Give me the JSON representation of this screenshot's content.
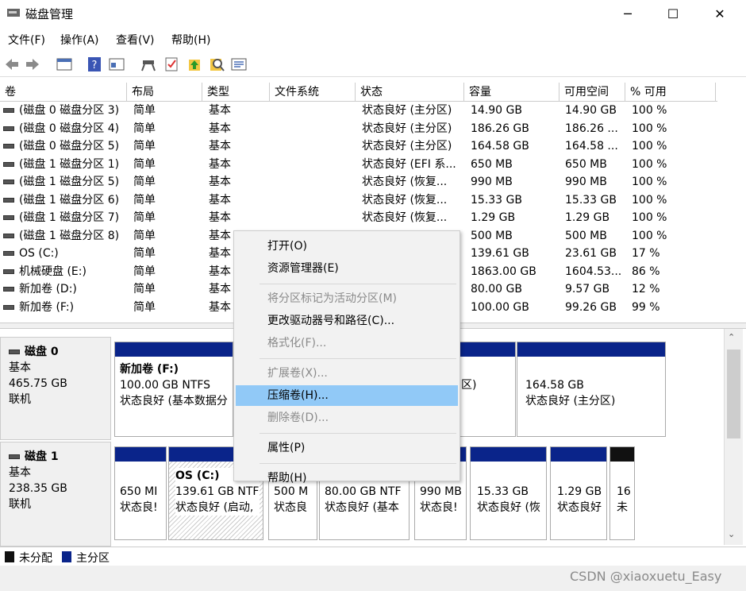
{
  "window": {
    "title": "磁盘管理",
    "minimize": "─",
    "maximize": "☐",
    "close": "✕"
  },
  "menu": [
    "文件(F)",
    "操作(A)",
    "查看(V)",
    "帮助(H)"
  ],
  "toolbar": [
    "back-icon",
    "forward-icon",
    "console-icon",
    "help-icon",
    "properties-icon",
    "connect-icon",
    "check-icon",
    "up-icon",
    "search-icon",
    "list-icon"
  ],
  "columns": [
    "卷",
    "布局",
    "类型",
    "文件系统",
    "状态",
    "容量",
    "可用空间",
    "% 可用"
  ],
  "volumes": [
    [
      "(磁盘 0 磁盘分区 3)",
      "简单",
      "基本",
      "",
      "状态良好 (主分区)",
      "14.90 GB",
      "14.90 GB",
      "100 %"
    ],
    [
      "(磁盘 0 磁盘分区 4)",
      "简单",
      "基本",
      "",
      "状态良好 (主分区)",
      "186.26 GB",
      "186.26 ...",
      "100 %"
    ],
    [
      "(磁盘 0 磁盘分区 5)",
      "简单",
      "基本",
      "",
      "状态良好 (主分区)",
      "164.58 GB",
      "164.58 ...",
      "100 %"
    ],
    [
      "(磁盘 1 磁盘分区 1)",
      "简单",
      "基本",
      "",
      "状态良好 (EFI 系...",
      "650 MB",
      "650 MB",
      "100 %"
    ],
    [
      "(磁盘 1 磁盘分区 5)",
      "简单",
      "基本",
      "",
      "状态良好 (恢复...",
      "990 MB",
      "990 MB",
      "100 %"
    ],
    [
      "(磁盘 1 磁盘分区 6)",
      "简单",
      "基本",
      "",
      "状态良好 (恢复...",
      "15.33 GB",
      "15.33 GB",
      "100 %"
    ],
    [
      "(磁盘 1 磁盘分区 7)",
      "简单",
      "基本",
      "",
      "状态良好 (恢复...",
      "1.29 GB",
      "1.29 GB",
      "100 %"
    ],
    [
      "(磁盘 1 磁盘分区 8)",
      "简单",
      "基本",
      "",
      "",
      "500 MB",
      "500 MB",
      "100 %"
    ],
    [
      "OS (C:)",
      "简单",
      "基本",
      "",
      "",
      "139.61 GB",
      "23.61 GB",
      "17 %"
    ],
    [
      "机械硬盘 (E:)",
      "简单",
      "基本",
      "",
      "",
      "1863.00 GB",
      "1604.53...",
      "86 %"
    ],
    [
      "新加卷 (D:)",
      "简单",
      "基本",
      "",
      "",
      "80.00 GB",
      "9.57 GB",
      "12 %"
    ],
    [
      "新加卷 (F:)",
      "简单",
      "基本",
      "",
      "",
      "100.00 GB",
      "99.26 GB",
      "99 %"
    ]
  ],
  "disks": [
    {
      "name": "磁盘 0",
      "type": "基本",
      "size": "465.75 GB",
      "state": "联机",
      "parts": [
        {
          "title": "新加卷  (F:)",
          "l1": "100.00 GB NTFS",
          "l2": "状态良好 (基本数据分"
        },
        {
          "title": "",
          "l1": "",
          "l2": "区)"
        },
        {
          "title": "",
          "l1": "164.58 GB",
          "l2": "状态良好 (主分区)"
        }
      ]
    },
    {
      "name": "磁盘 1",
      "type": "基本",
      "size": "238.35 GB",
      "state": "联机",
      "parts": [
        {
          "title": "",
          "l1": "650 MI",
          "l2": "状态良!"
        },
        {
          "title": "OS  (C:)",
          "l1": "139.61 GB NTF",
          "l2": "状态良好 (启动,"
        },
        {
          "title": "",
          "l1": "500 M",
          "l2": "状态良"
        },
        {
          "title": "",
          "l1": "80.00 GB NTF",
          "l2": "状态良好 (基本"
        },
        {
          "title": "",
          "l1": "990 MB",
          "l2": "状态良!"
        },
        {
          "title": "",
          "l1": "15.33 GB",
          "l2": "状态良好 (恢"
        },
        {
          "title": "",
          "l1": "1.29 GB",
          "l2": "状态良好"
        },
        {
          "title": "",
          "l1": "16",
          "l2": "未"
        }
      ]
    }
  ],
  "legend": {
    "unallocated": "未分配",
    "primary": "主分区"
  },
  "context_menu": [
    {
      "label": "打开(O)",
      "enabled": true
    },
    {
      "label": "资源管理器(E)",
      "enabled": true
    },
    {
      "sep": true
    },
    {
      "label": "将分区标记为活动分区(M)",
      "enabled": false
    },
    {
      "label": "更改驱动器号和路径(C)...",
      "enabled": true
    },
    {
      "label": "格式化(F)...",
      "enabled": false
    },
    {
      "sep": true
    },
    {
      "label": "扩展卷(X)...",
      "enabled": false
    },
    {
      "label": "压缩卷(H)...",
      "enabled": true,
      "highlighted": true
    },
    {
      "label": "删除卷(D)...",
      "enabled": false
    },
    {
      "sep": true
    },
    {
      "label": "属性(P)",
      "enabled": true
    },
    {
      "sep": true
    },
    {
      "label": "帮助(H)",
      "enabled": true
    }
  ],
  "watermark": "CSDN @xiaoxuetu_Easy",
  "colors": {
    "primary": "#0a248a",
    "highlight": "#91c9f7",
    "unallocated": "#111111"
  }
}
